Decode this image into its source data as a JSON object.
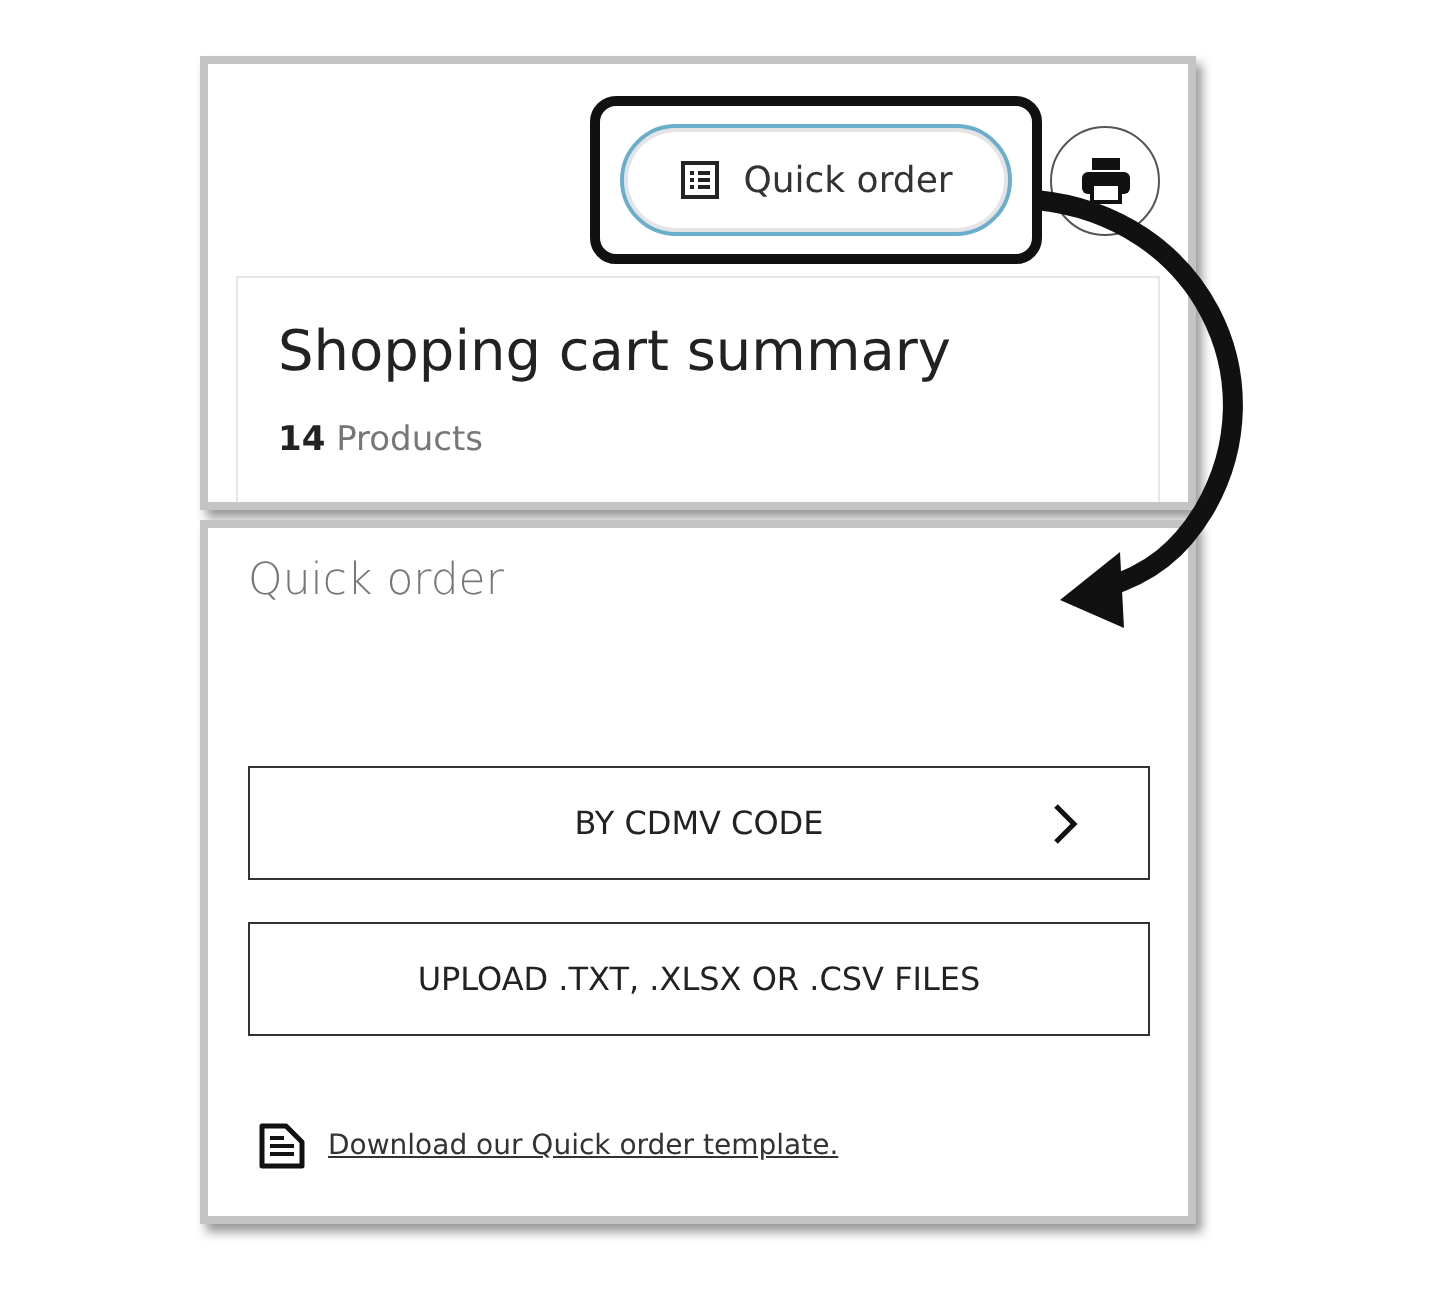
{
  "top_panel": {
    "quick_order_button": {
      "label": "Quick order",
      "highlighted": true
    },
    "cart_summary": {
      "title": "Shopping cart summary",
      "count": "14",
      "count_label": "Products"
    }
  },
  "quick_order_panel": {
    "title": "Quick order",
    "options": [
      {
        "label": "BY CDMV CODE",
        "kind": "navigate"
      },
      {
        "label": "UPLOAD .TXT, .XLSX OR .CSV FILES",
        "kind": "upload"
      }
    ],
    "template_link": "Download our Quick order template."
  }
}
